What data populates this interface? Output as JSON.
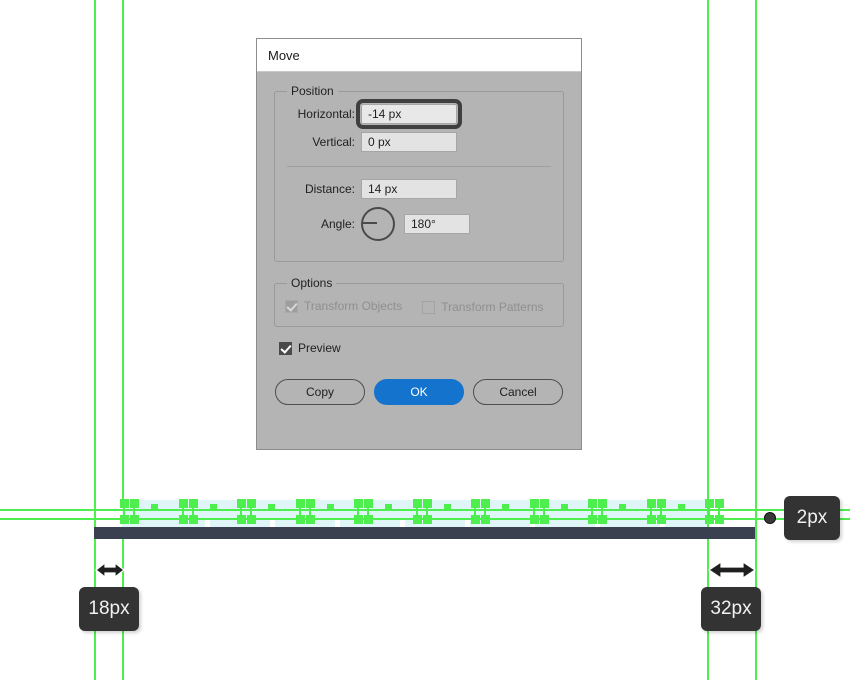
{
  "canvas": {
    "guides_color": "#4dee4d",
    "artwork_bar_color": "#3a4050",
    "selection_fill_color": "#dff5f7",
    "vertical_guides_x": [
      94,
      122,
      707,
      755
    ],
    "horizontal_guides_y": [
      509,
      518
    ],
    "measurements": [
      {
        "name": "right-offset",
        "label": "2px",
        "icon": "anchor-dot-icon"
      },
      {
        "name": "left-gap",
        "label": "18px",
        "icon": "horizontal-resize-arrow-icon"
      },
      {
        "name": "right-gap",
        "label": "32px",
        "icon": "horizontal-resize-arrow-icon"
      }
    ]
  },
  "dialog": {
    "title": "Move",
    "position": {
      "legend": "Position",
      "horizontal": {
        "label": "Horizontal:",
        "value": "-14 px",
        "focused": true
      },
      "vertical": {
        "label": "Vertical:",
        "value": "0 px",
        "focused": false
      },
      "distance": {
        "label": "Distance:",
        "value": "14 px",
        "focused": false
      },
      "angle": {
        "label": "Angle:",
        "value": "180°",
        "dial_icon": "angle-dial-icon",
        "focused": false
      }
    },
    "options": {
      "legend": "Options",
      "transform_objects": {
        "label": "Transform Objects",
        "checked": true,
        "disabled": true
      },
      "transform_patterns": {
        "label": "Transform Patterns",
        "checked": false,
        "disabled": true
      }
    },
    "preview": {
      "label": "Preview",
      "checked": true
    },
    "buttons": {
      "copy": "Copy",
      "ok": "OK",
      "cancel": "Cancel",
      "primary_color": "#1473cc"
    }
  }
}
